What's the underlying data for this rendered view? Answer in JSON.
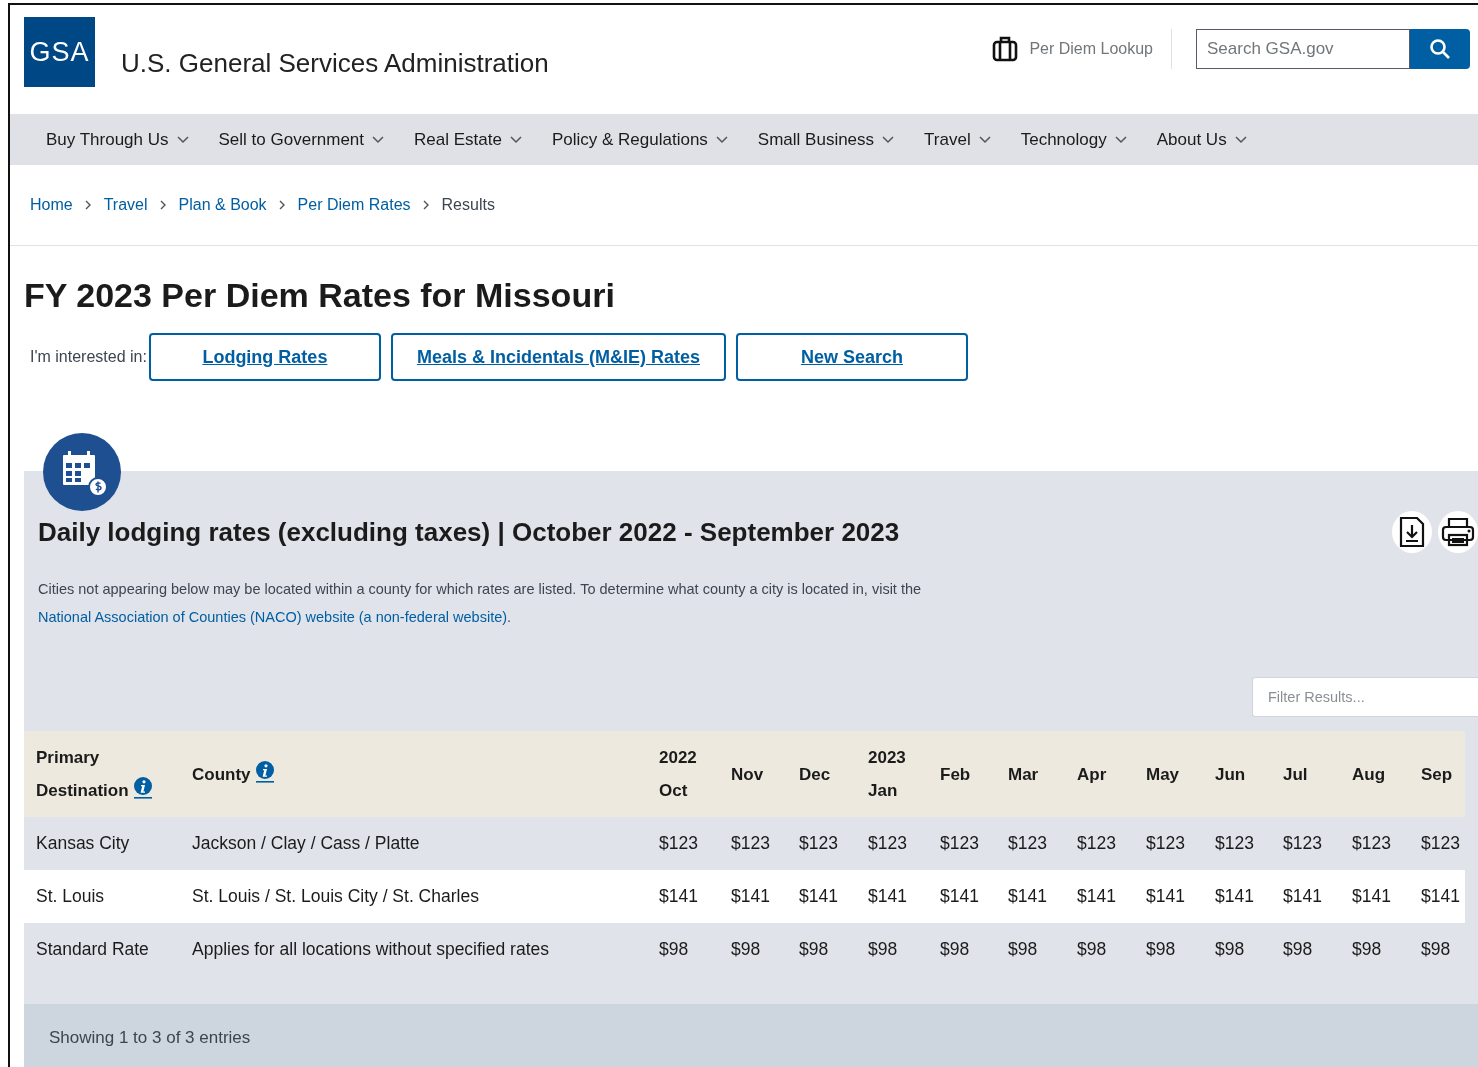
{
  "header": {
    "logo": "GSA",
    "site_title": "U.S. General Services Administration",
    "lookup_link": "Per Diem Lookup",
    "search": {
      "placeholder": "Search GSA.gov"
    }
  },
  "nav": [
    "Buy Through Us",
    "Sell to Government",
    "Real Estate",
    "Policy & Regulations",
    "Small Business",
    "Travel",
    "Technology",
    "About Us"
  ],
  "breadcrumb": [
    {
      "label": "Home",
      "current": false
    },
    {
      "label": "Travel",
      "current": false
    },
    {
      "label": "Plan & Book",
      "current": false
    },
    {
      "label": "Per Diem Rates",
      "current": false
    },
    {
      "label": "Results",
      "current": true
    }
  ],
  "page_title": "FY 2023 Per Diem Rates for Missouri",
  "interest": {
    "label": "I'm interested in:",
    "buttons": [
      "Lodging Rates",
      "Meals & Incidentals (M&IE) Rates",
      "New Search"
    ]
  },
  "rates_panel": {
    "title": "Daily lodging rates (excluding taxes) | October 2022 - September 2023",
    "note": "Cities not appearing below may be located within a county for which rates are listed. To determine what county a city is located in, visit the",
    "note_link": "National Association of Counties (NACO) website (a non-federal website)",
    "note_end": ".",
    "filter": {
      "placeholder": "Filter Results..."
    },
    "table": {
      "columns": [
        {
          "label": "Primary Destination",
          "info": true
        },
        {
          "label": "County",
          "info": true
        },
        {
          "year": "2022",
          "label": "Oct",
          "info": false
        },
        {
          "label": "Nov",
          "info": false
        },
        {
          "label": "Dec",
          "info": false
        },
        {
          "year": "2023",
          "label": "Jan",
          "info": false
        },
        {
          "label": "Feb",
          "info": false
        },
        {
          "label": "Mar",
          "info": false
        },
        {
          "label": "Apr",
          "info": false
        },
        {
          "label": "May",
          "info": false
        },
        {
          "label": "Jun",
          "info": false
        },
        {
          "label": "Jul",
          "info": false
        },
        {
          "label": "Aug",
          "info": false
        },
        {
          "label": "Sep",
          "info": false
        }
      ],
      "rows": [
        [
          "Kansas City",
          "Jackson / Clay / Cass / Platte",
          "$123",
          "$123",
          "$123",
          "$123",
          "$123",
          "$123",
          "$123",
          "$123",
          "$123",
          "$123",
          "$123",
          "$123"
        ],
        [
          "St. Louis",
          "St. Louis / St. Louis City / St. Charles",
          "$141",
          "$141",
          "$141",
          "$141",
          "$141",
          "$141",
          "$141",
          "$141",
          "$141",
          "$141",
          "$141",
          "$141"
        ],
        [
          "Standard Rate",
          "Applies for all locations without specified rates",
          "$98",
          "$98",
          "$98",
          "$98",
          "$98",
          "$98",
          "$98",
          "$98",
          "$98",
          "$98",
          "$98",
          "$98"
        ]
      ]
    },
    "footer": "Showing 1 to 3 of 3 entries"
  }
}
